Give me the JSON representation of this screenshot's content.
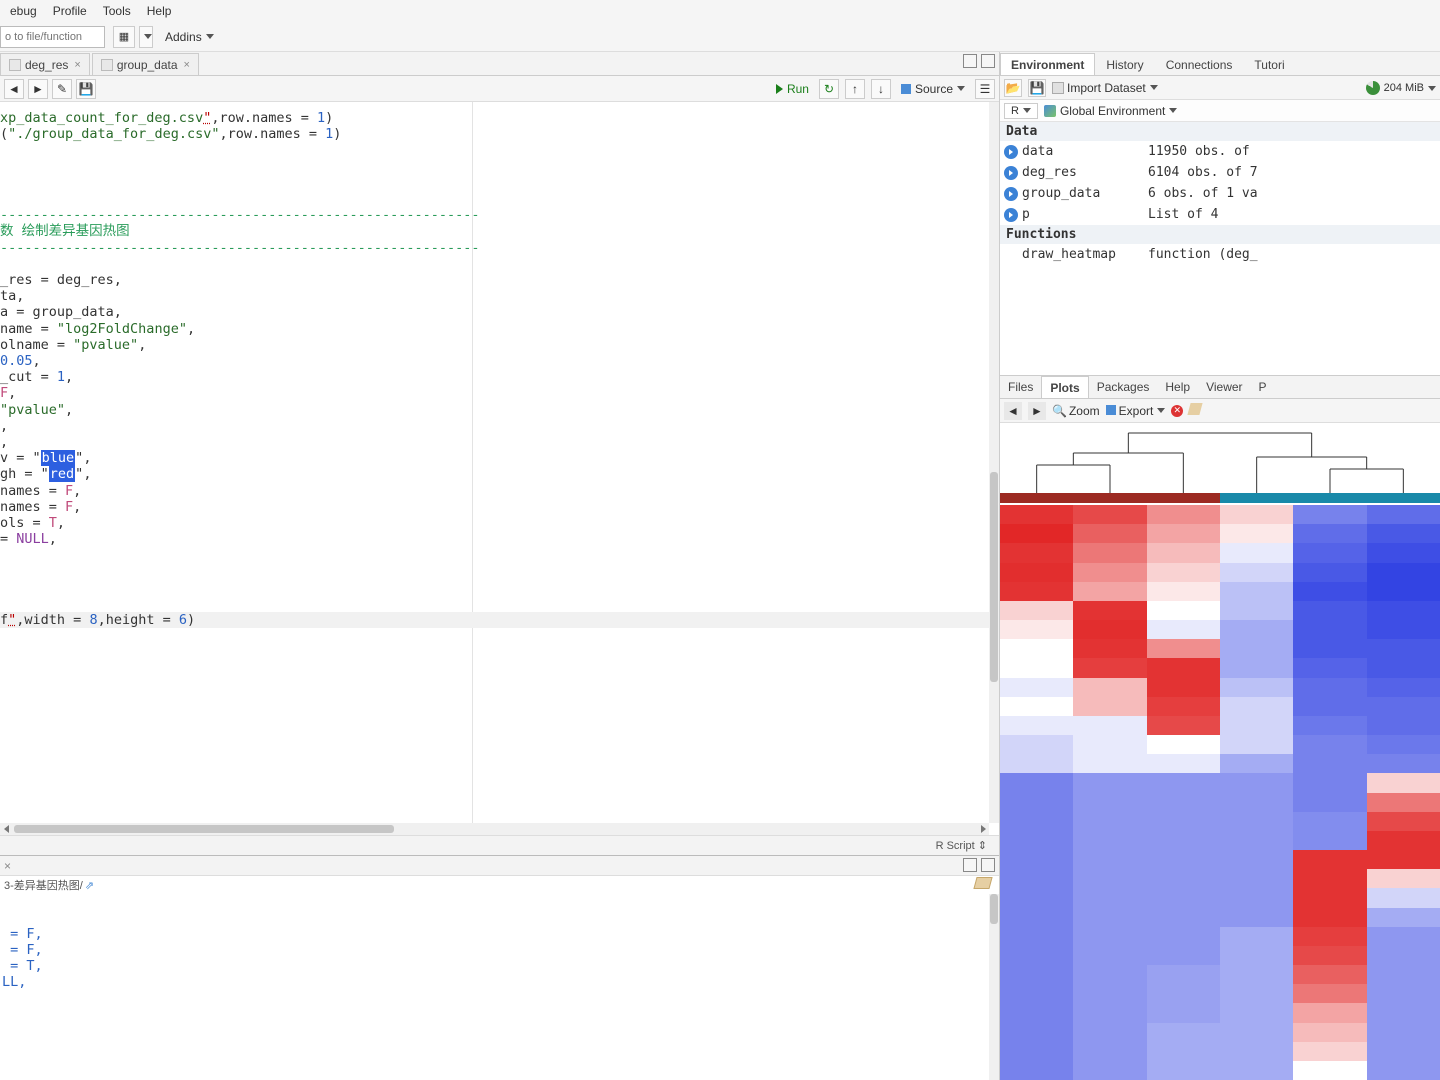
{
  "menu": {
    "items": [
      "ebug",
      "Profile",
      "Tools",
      "Help"
    ]
  },
  "toolbar": {
    "file_search_placeholder": "o to file/function",
    "addins_label": "Addins"
  },
  "tabs": [
    {
      "label": "deg_res"
    },
    {
      "label": "group_data"
    }
  ],
  "src_toolbar": {
    "run_label": "Run",
    "source_label": "Source"
  },
  "code_lines": [
    {
      "segments": [
        {
          "t": "xp_data_count_for_deg.csv",
          "c": "c-str"
        },
        {
          "t": "\"",
          "c": "c-err"
        },
        {
          "t": ",row.names = "
        },
        {
          "t": "1",
          "c": "c-num"
        },
        {
          "t": ")"
        }
      ]
    },
    {
      "segments": [
        {
          "t": "("
        },
        {
          "t": "\"./group_data_for_deg.csv\"",
          "c": "c-str"
        },
        {
          "t": ",row.names = "
        },
        {
          "t": "1",
          "c": "c-num"
        },
        {
          "t": ")"
        }
      ]
    },
    {
      "segments": [
        {
          "t": ""
        }
      ]
    },
    {
      "segments": [
        {
          "t": ""
        }
      ]
    },
    {
      "segments": [
        {
          "t": ""
        }
      ]
    },
    {
      "segments": [
        {
          "t": ""
        }
      ]
    },
    {
      "segments": [
        {
          "t": "-----------------------------------------------------------",
          "c": "c-comment"
        }
      ]
    },
    {
      "segments": [
        {
          "t": "数 绘制差异基因热图",
          "c": "c-comment"
        }
      ]
    },
    {
      "segments": [
        {
          "t": "-----------------------------------------------------------",
          "c": "c-comment"
        }
      ]
    },
    {
      "segments": [
        {
          "t": ""
        }
      ]
    },
    {
      "segments": [
        {
          "t": "_res = deg_res,"
        }
      ]
    },
    {
      "segments": [
        {
          "t": "ta,"
        }
      ]
    },
    {
      "segments": [
        {
          "t": "a = group_data,"
        }
      ]
    },
    {
      "segments": [
        {
          "t": "name = "
        },
        {
          "t": "\"log2FoldChange\"",
          "c": "c-str"
        },
        {
          "t": ","
        }
      ]
    },
    {
      "segments": [
        {
          "t": "olname = "
        },
        {
          "t": "\"pvalue\"",
          "c": "c-str"
        },
        {
          "t": ","
        }
      ]
    },
    {
      "segments": [
        {
          "t": "0.05",
          "c": "c-num"
        },
        {
          "t": ","
        }
      ]
    },
    {
      "segments": [
        {
          "t": "_cut = "
        },
        {
          "t": "1",
          "c": "c-num"
        },
        {
          "t": ","
        }
      ]
    },
    {
      "segments": [
        {
          "t": "F",
          "c": "c-bool"
        },
        {
          "t": ","
        }
      ]
    },
    {
      "segments": [
        {
          "t": ""
        },
        {
          "t": "\"pvalue\"",
          "c": "c-str"
        },
        {
          "t": ","
        }
      ]
    },
    {
      "segments": [
        {
          "t": ","
        }
      ]
    },
    {
      "segments": [
        {
          "t": ","
        }
      ]
    },
    {
      "segments": [
        {
          "t": "v = "
        },
        {
          "t": "\""
        },
        {
          "t": "blue",
          "sel": true
        },
        {
          "t": "\""
        },
        {
          "t": ","
        }
      ]
    },
    {
      "segments": [
        {
          "t": "gh = "
        },
        {
          "t": "\""
        },
        {
          "t": "red",
          "sel": true
        },
        {
          "t": "\""
        },
        {
          "t": ","
        }
      ]
    },
    {
      "segments": [
        {
          "t": "names = "
        },
        {
          "t": "F",
          "c": "c-bool"
        },
        {
          "t": ","
        }
      ]
    },
    {
      "segments": [
        {
          "t": "names = "
        },
        {
          "t": "F",
          "c": "c-bool"
        },
        {
          "t": ","
        }
      ]
    },
    {
      "segments": [
        {
          "t": "ols = "
        },
        {
          "t": "T",
          "c": "c-bool"
        },
        {
          "t": ","
        }
      ]
    },
    {
      "segments": [
        {
          "t": "= "
        },
        {
          "t": "NULL",
          "c": "c-null"
        },
        {
          "t": ","
        }
      ]
    },
    {
      "segments": [
        {
          "t": ""
        }
      ]
    },
    {
      "segments": [
        {
          "t": ""
        }
      ]
    },
    {
      "segments": [
        {
          "t": ""
        }
      ]
    },
    {
      "segments": [
        {
          "t": ""
        }
      ]
    },
    {
      "current": true,
      "segments": [
        {
          "t": "f"
        },
        {
          "t": "\"",
          "c": "c-err"
        },
        {
          "t": ",width = "
        },
        {
          "t": "8",
          "c": "c-num"
        },
        {
          "t": ",height = "
        },
        {
          "t": "6",
          "c": "c-num"
        },
        {
          "t": ")"
        }
      ]
    },
    {
      "segments": [
        {
          "t": ""
        }
      ]
    }
  ],
  "status": {
    "lang": "R Script"
  },
  "console": {
    "path": "3-差异基因热图/",
    "lines": [
      " = F,",
      " = F,",
      " = T,",
      "LL,",
      ""
    ]
  },
  "env": {
    "tabs": [
      "Environment",
      "History",
      "Connections",
      "Tutori"
    ],
    "active_tab": 0,
    "import_label": "Import Dataset",
    "memory": "204 MiB",
    "scope_r": "R",
    "scope_global": "Global Environment",
    "sections": [
      {
        "title": "Data",
        "rows": [
          {
            "name": "data",
            "val": "11950 obs. of",
            "exp": true
          },
          {
            "name": "deg_res",
            "val": "6104 obs. of 7",
            "exp": true
          },
          {
            "name": "group_data",
            "val": "6 obs. of 1 va",
            "exp": true
          },
          {
            "name": "p",
            "val": "List of  4",
            "exp": true
          }
        ]
      },
      {
        "title": "Functions",
        "rows": [
          {
            "name": "draw_heatmap",
            "val": "function (deg_",
            "exp": false
          }
        ]
      }
    ]
  },
  "plots": {
    "tabs": [
      "Files",
      "Plots",
      "Packages",
      "Help",
      "Viewer",
      "P"
    ],
    "active_tab": 1,
    "zoom_label": "Zoom",
    "export_label": "Export"
  },
  "chart_data": {
    "type": "heatmap",
    "title": "",
    "columns": 6,
    "rows_approx": 60,
    "column_annotation_groups": [
      {
        "color": "#9c2a22",
        "span": [
          0,
          3
        ]
      },
      {
        "color": "#1989a9",
        "span": [
          3,
          6
        ]
      }
    ],
    "color_scale": {
      "low": "#1c2fe0",
      "mid": "#ffffff",
      "high": "#e01c1c"
    },
    "dendrogram_top": true,
    "matrix": [
      [
        0.9,
        0.8,
        0.5,
        0.2,
        -0.6,
        -0.7
      ],
      [
        0.95,
        0.7,
        0.4,
        0.1,
        -0.7,
        -0.8
      ],
      [
        0.9,
        0.6,
        0.3,
        -0.1,
        -0.75,
        -0.85
      ],
      [
        0.92,
        0.5,
        0.2,
        -0.2,
        -0.8,
        -0.9
      ],
      [
        0.9,
        0.4,
        0.1,
        -0.3,
        -0.85,
        -0.9
      ],
      [
        0.2,
        0.9,
        0.0,
        -0.3,
        -0.8,
        -0.85
      ],
      [
        0.1,
        0.92,
        -0.1,
        -0.4,
        -0.8,
        -0.85
      ],
      [
        0.0,
        0.9,
        0.5,
        -0.4,
        -0.8,
        -0.8
      ],
      [
        0.0,
        0.85,
        0.9,
        -0.4,
        -0.75,
        -0.8
      ],
      [
        -0.1,
        0.3,
        0.9,
        -0.3,
        -0.7,
        -0.75
      ],
      [
        0.0,
        0.3,
        0.85,
        -0.2,
        -0.7,
        -0.7
      ],
      [
        -0.1,
        -0.1,
        0.8,
        -0.2,
        -0.65,
        -0.7
      ],
      [
        -0.2,
        -0.1,
        0.0,
        -0.2,
        -0.6,
        -0.65
      ],
      [
        -0.2,
        -0.1,
        -0.1,
        -0.4,
        -0.6,
        -0.6
      ],
      [
        -0.6,
        -0.5,
        -0.5,
        -0.5,
        -0.6,
        0.2
      ],
      [
        -0.6,
        -0.5,
        -0.5,
        -0.5,
        -0.6,
        0.6
      ],
      [
        -0.6,
        -0.5,
        -0.5,
        -0.5,
        -0.55,
        0.8
      ],
      [
        -0.6,
        -0.5,
        -0.5,
        -0.5,
        -0.55,
        0.9
      ],
      [
        -0.6,
        -0.5,
        -0.5,
        -0.5,
        0.9,
        0.9
      ],
      [
        -0.6,
        -0.5,
        -0.5,
        -0.5,
        0.9,
        0.2
      ],
      [
        -0.6,
        -0.5,
        -0.5,
        -0.5,
        0.9,
        -0.2
      ],
      [
        -0.6,
        -0.5,
        -0.5,
        -0.5,
        0.9,
        -0.4
      ],
      [
        -0.6,
        -0.5,
        -0.5,
        -0.4,
        0.85,
        -0.5
      ],
      [
        -0.6,
        -0.5,
        -0.5,
        -0.4,
        0.8,
        -0.5
      ],
      [
        -0.6,
        -0.5,
        -0.45,
        -0.4,
        0.7,
        -0.5
      ],
      [
        -0.6,
        -0.5,
        -0.45,
        -0.4,
        0.6,
        -0.5
      ],
      [
        -0.6,
        -0.5,
        -0.45,
        -0.4,
        0.4,
        -0.5
      ],
      [
        -0.6,
        -0.5,
        -0.4,
        -0.4,
        0.3,
        -0.5
      ],
      [
        -0.6,
        -0.5,
        -0.4,
        -0.4,
        0.2,
        -0.5
      ],
      [
        -0.6,
        -0.5,
        -0.4,
        -0.4,
        0.0,
        -0.5
      ]
    ]
  }
}
